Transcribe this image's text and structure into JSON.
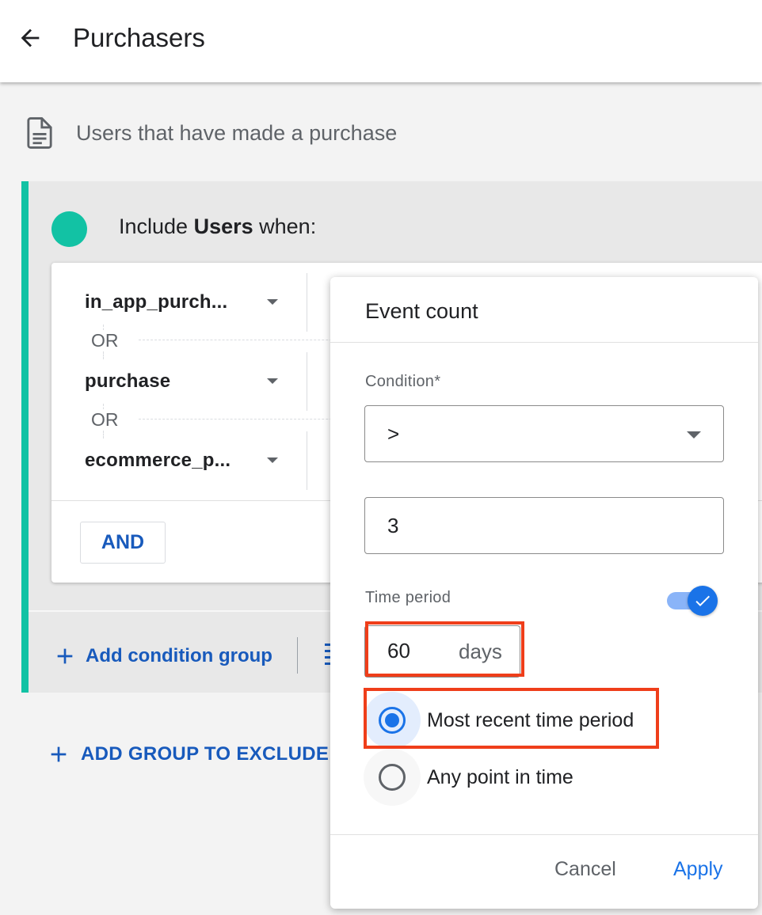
{
  "header": {
    "title": "Purchasers"
  },
  "description": "Users that have made a purchase",
  "include_group": {
    "prefix": "Include ",
    "subject": "Users",
    "suffix": " when:",
    "events": [
      "in_app_purch...",
      "purchase",
      "ecommerce_p..."
    ],
    "or_label": "OR",
    "and_label": "AND",
    "add_condition_group": "Add condition group"
  },
  "add_exclude": "ADD GROUP TO EXCLUDE",
  "popup": {
    "title": "Event count",
    "condition_label": "Condition*",
    "condition_value": ">",
    "count_value": "3",
    "time_period_label": "Time period",
    "time_period_enabled": true,
    "days_value": "60",
    "days_unit": "days",
    "radio_options": [
      "Most recent time period",
      "Any point in time"
    ],
    "selected_option": "Most recent time period",
    "cancel_label": "Cancel",
    "apply_label": "Apply"
  },
  "colors": {
    "accent": "#12c2a4",
    "primary": "#1a73e8",
    "link": "#185abc",
    "highlight": "#ef3e1a"
  }
}
